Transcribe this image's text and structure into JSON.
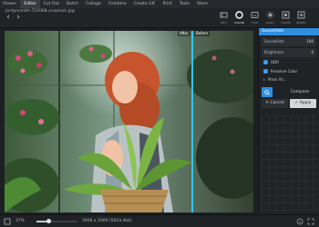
{
  "menu": {
    "items": [
      {
        "label": "Viewer",
        "active": false
      },
      {
        "label": "Editor",
        "active": true
      },
      {
        "label": "Cut Out",
        "active": false
      },
      {
        "label": "Batch",
        "active": false
      },
      {
        "label": "Collage",
        "active": false
      },
      {
        "label": "Combine",
        "active": false
      },
      {
        "label": "Create GIF",
        "active": false
      },
      {
        "label": "Print",
        "active": false
      },
      {
        "label": "Tools",
        "active": false
      },
      {
        "label": "Store",
        "active": false
      }
    ]
  },
  "toolbar": {
    "filename": "jordynsmith-722068-unsplash.jpg",
    "tools": [
      {
        "label": "EDIT",
        "icon": "edit-icon",
        "active": false
      },
      {
        "label": "COLOR",
        "icon": "color-icon",
        "active": true
      },
      {
        "label": "FILM",
        "icon": "film-icon",
        "active": false
      },
      {
        "label": "LIGHT",
        "icon": "light-icon",
        "active": false
      },
      {
        "label": "FRAME",
        "icon": "frame-icon",
        "active": false
      },
      {
        "label": "INSERT",
        "icon": "insert-icon",
        "active": false
      }
    ]
  },
  "canvas": {
    "after_label": "After",
    "before_label": "Before",
    "split_fraction": 0.75
  },
  "panel": {
    "title": "Sunsetlists",
    "sliders": [
      {
        "label": "Sunsetlists",
        "value": "100"
      },
      {
        "label": "Brightness",
        "value": "0"
      }
    ],
    "checks": [
      {
        "label": "HDR",
        "checked": true
      },
      {
        "label": "Preserve Color",
        "checked": true
      }
    ],
    "expand_label": "Mask All...",
    "compare_label": "Compare",
    "cancel_label": "Cancel",
    "apply_label": "Apply"
  },
  "status": {
    "zoom": "37%",
    "zoom_fraction": 0.3,
    "dimensions": "3000 x 2000  (5643.4kb)"
  },
  "colors": {
    "accent": "#2e8fe0",
    "split_line": "#2ec8ef",
    "background": "#1b1d20"
  }
}
